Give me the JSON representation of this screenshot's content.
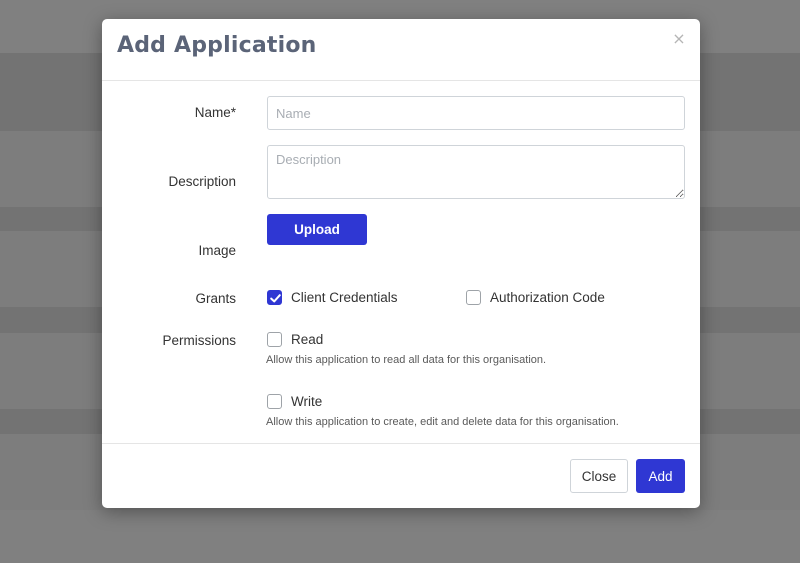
{
  "modal": {
    "title": "Add Application",
    "close_icon": "×"
  },
  "form": {
    "name": {
      "label": "Name*",
      "value": "",
      "placeholder": "Name"
    },
    "description": {
      "label": "Description",
      "value": "",
      "placeholder": "Description"
    },
    "image": {
      "label": "Image",
      "upload_label": "Upload"
    },
    "grants": {
      "label": "Grants",
      "options": [
        {
          "label": "Client Credentials",
          "checked": true
        },
        {
          "label": "Authorization Code",
          "checked": false
        }
      ]
    },
    "permissions": {
      "label": "Permissions",
      "options": [
        {
          "label": "Read",
          "checked": false,
          "help": "Allow this application to read all data for this organisation."
        },
        {
          "label": "Write",
          "checked": false,
          "help": "Allow this application to create, edit and delete data for this organisation."
        }
      ]
    }
  },
  "footer": {
    "close_label": "Close",
    "add_label": "Add"
  },
  "colors": {
    "primary": "#2f37d3",
    "title": "#5b6478",
    "overlay": "#7b7b7b"
  }
}
